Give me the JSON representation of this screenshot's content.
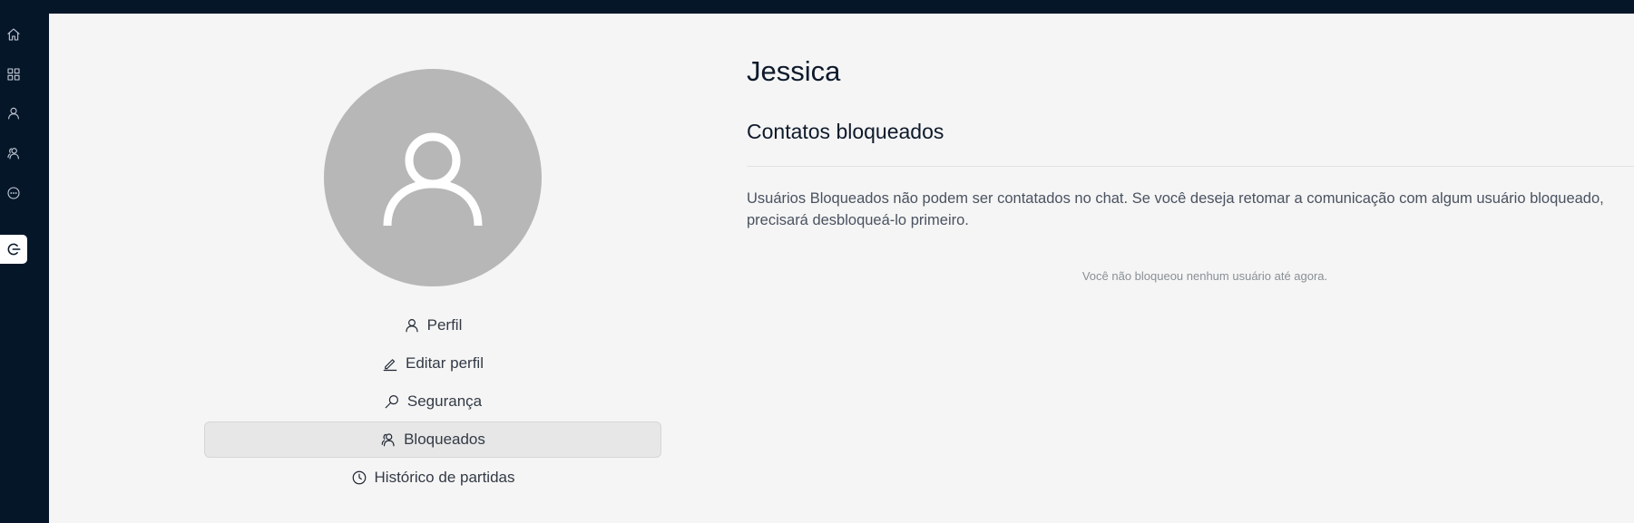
{
  "sidebar": {
    "icons": [
      "home-icon",
      "grid-icon",
      "user-icon",
      "users-icon",
      "chat-icon",
      "logout-icon"
    ]
  },
  "profile": {
    "avatar_icon": "user-silhouette-icon"
  },
  "menu": {
    "items": [
      {
        "label": "Perfil",
        "icon": "user-icon"
      },
      {
        "label": "Editar perfil",
        "icon": "pencil-icon"
      },
      {
        "label": "Segurança",
        "icon": "key-icon"
      },
      {
        "label": "Bloqueados",
        "icon": "blocked-users-icon",
        "active": true
      },
      {
        "label": "Histórico de partidas",
        "icon": "clock-icon"
      }
    ]
  },
  "content": {
    "name": "Jessica",
    "section_title": "Contatos bloqueados",
    "description": "Usuários Bloqueados não podem ser contatados no chat. Se você deseja retomar a comunicação com algum usuário bloqueado, precisará desbloqueá-lo primeiro.",
    "empty_message": "Você não bloqueou nenhum usuário até agora."
  },
  "colors": {
    "sidebar_bg": "#061629",
    "main_bg": "#f5f5f5",
    "avatar_bg": "#b7b7b7",
    "active_item_bg": "#e7e7e7"
  }
}
